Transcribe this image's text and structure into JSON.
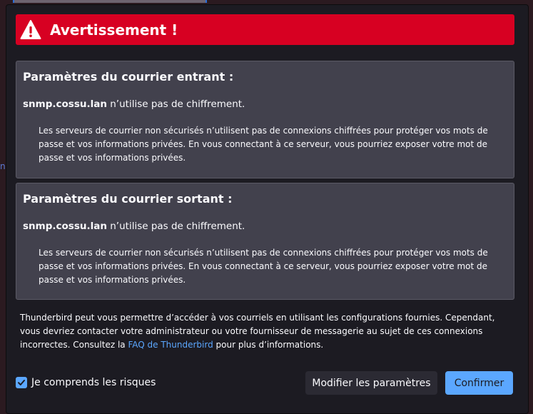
{
  "alert": {
    "title": "Avertissement !"
  },
  "incoming": {
    "title": "Paramètres du courrier entrant :",
    "host": "snmp.cossu.lan",
    "status": " n’utilise pas de chiffrement.",
    "description": "Les serveurs de courrier non sécurisés n’utilisent pas de connexions chiffrées pour protéger vos mots de passe et vos informations privées. En vous connectant à ce serveur, vous pourriez exposer votre mot de passe et vos informations privées."
  },
  "outgoing": {
    "title": "Paramètres du courrier sortant :",
    "host": "snmp.cossu.lan",
    "status": " n’utilise pas de chiffrement.",
    "description": "Les serveurs de courrier non sécurisés n’utilisent pas de connexions chiffrées pour protéger vos mots de passe et vos informations privées. En vous connectant à ce serveur, vous pourriez exposer votre mot de passe et vos informations privées."
  },
  "footer": {
    "text_before": "Thunderbird peut vous permettre d’accéder à vos courriels en utilisant les configurations fournies. Cependant, vous devriez contacter votre administrateur ou votre fournisseur de messagerie au sujet de ces connexions incorrectes. Consultez la ",
    "link": "FAQ de Thunderbird",
    "text_after": " pour plus d’informations."
  },
  "controls": {
    "checkbox_label": "Je comprends les risques",
    "checkbox_checked": true,
    "modify_label": "Modifier les paramètres",
    "confirm_label": "Confirmer"
  },
  "colors": {
    "alert_red": "#d70022",
    "accent_blue": "#5ba7ff",
    "dialog_bg": "#1c1b22",
    "section_bg": "#42414d"
  },
  "icons": {
    "alert": "warning-icon",
    "check": "checkmark-icon"
  }
}
